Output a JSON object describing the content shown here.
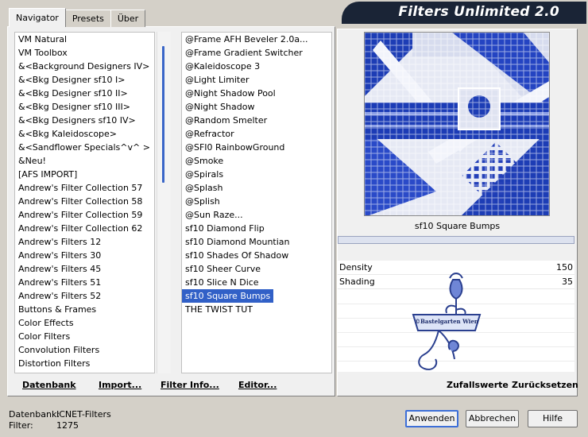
{
  "app": {
    "title": "Filters Unlimited 2.0"
  },
  "tabs": [
    {
      "label": "Navigator",
      "active": true
    },
    {
      "label": "Presets",
      "active": false
    },
    {
      "label": "Über",
      "active": false
    }
  ],
  "categories": [
    "VM Natural",
    "VM Toolbox",
    "&<Background Designers IV>",
    "&<Bkg Designer sf10 I>",
    "&<Bkg Designer sf10 II>",
    "&<Bkg Designer sf10 III>",
    "&<Bkg Designers sf10 IV>",
    "&<Bkg Kaleidoscope>",
    "&<Sandflower Specials^v^ >",
    "&Neu!",
    "[AFS IMPORT]",
    "Andrew's Filter Collection 57",
    "Andrew's Filter Collection 58",
    "Andrew's Filter Collection 59",
    "Andrew's Filter Collection 62",
    "Andrew's Filters 12",
    "Andrew's Filters 30",
    "Andrew's Filters 45",
    "Andrew's Filters 51",
    "Andrew's Filters 52",
    "Buttons & Frames",
    "Color Effects",
    "Color Filters",
    "Convolution Filters",
    "Distortion Filters"
  ],
  "filters": [
    "@Frame AFH Beveler 2.0a...",
    "@Frame Gradient Switcher",
    "@Kaleidoscope 3",
    "@Light Limiter",
    "@Night Shadow Pool",
    "@Night Shadow",
    "@Random Smelter",
    "@Refractor",
    "@SFI0 RainbowGround",
    "@Smoke",
    "@Spirals",
    "@Splash",
    "@Splish",
    "@Sun Raze...",
    "sf10 Diamond Flip",
    "sf10 Diamond Mountian",
    "sf10 Shades Of Shadow",
    "sf10 Sheer Curve",
    "sf10 Slice N Dice",
    "sf10 Square Bumps",
    "THE TWIST TUT"
  ],
  "selected_filter": "sf10 Square Bumps",
  "preview": {
    "filter_name": "sf10 Square Bumps"
  },
  "params": [
    {
      "label": "Density",
      "value": "150"
    },
    {
      "label": "Shading",
      "value": "35"
    }
  ],
  "watermark_text": "©Bastelgarten Wien",
  "left_buttons": {
    "database": "Datenbank",
    "import": "Import...",
    "filter_info": "Filter Info...",
    "editor": "Editor..."
  },
  "right_buttons": {
    "randomize": "Zufallswerte",
    "reset": "Zurücksetzen"
  },
  "status": {
    "db_label": "Datenbank:",
    "db_value": "ICNET-Filters",
    "filter_label": "Filter:",
    "filter_value": "1275"
  },
  "dialog_buttons": {
    "apply": "Anwenden",
    "cancel": "Abbrechen",
    "help": "Hilfe"
  },
  "colors": {
    "selection": "#3160c7",
    "banner": "#1a2436",
    "accent_blue": "#1e3fb8"
  }
}
